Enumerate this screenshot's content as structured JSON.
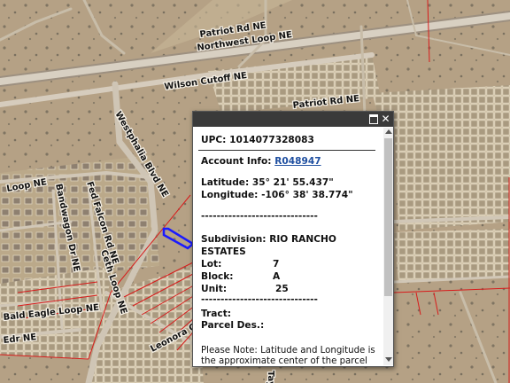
{
  "map": {
    "roads": [
      {
        "id": "patriot",
        "label": "Patriot Rd NE"
      },
      {
        "id": "northwest",
        "label": "Northwest Loop NE"
      },
      {
        "id": "wilson",
        "label": "Wilson Cutoff NE"
      },
      {
        "id": "westphalia",
        "label": "Westphalia Blvd NE"
      },
      {
        "id": "patriot2",
        "label": "Patriot Rd NE"
      },
      {
        "id": "loop",
        "label": "Loop NE"
      },
      {
        "id": "bandwagon",
        "label": "Bandwagon Dr NE"
      },
      {
        "id": "fedfacon",
        "label": "Fed Falcon Rd NE"
      },
      {
        "id": "ceth",
        "label": "Ceth Loop NE"
      },
      {
        "id": "bald",
        "label": "Bald Eagle Loop NE"
      },
      {
        "id": "edr",
        "label": "Edr NE"
      },
      {
        "id": "leon",
        "label": "Leonora Cir NE"
      },
      {
        "id": "tay",
        "label": "Tay"
      }
    ],
    "colors": {
      "parcel_line": "#d81b1b",
      "selected_parcel": "#1a1aff",
      "terrain": "#b9a98f"
    }
  },
  "popup": {
    "upc_label": "UPC:",
    "upc_value": "1014077328083",
    "account_label": "Account Info:",
    "account_value": "R048947",
    "latitude_label": "Latitude:",
    "latitude_value": "35° 21' 55.437\"",
    "longitude_label": "Longitude:",
    "longitude_value": "-106° 38' 38.774\"",
    "separator": "------------------------------",
    "subdivision_label": "Subdivision:",
    "subdivision_value": "RIO RANCHO",
    "subdivision_value2": "ESTATES",
    "lot_label": "Lot:",
    "lot_value": "7",
    "block_label": "Block:",
    "block_value": "A",
    "unit_label": "Unit:",
    "unit_value": "25",
    "tract_label": "Tract:",
    "parcel_label": "Parcel Des.:",
    "note": "Please Note: Latitude and Longitude is the approximate center of the parcel shown.",
    "maximize_icon": "maximize-icon",
    "close_icon": "close-icon",
    "close_glyph": "✕"
  }
}
